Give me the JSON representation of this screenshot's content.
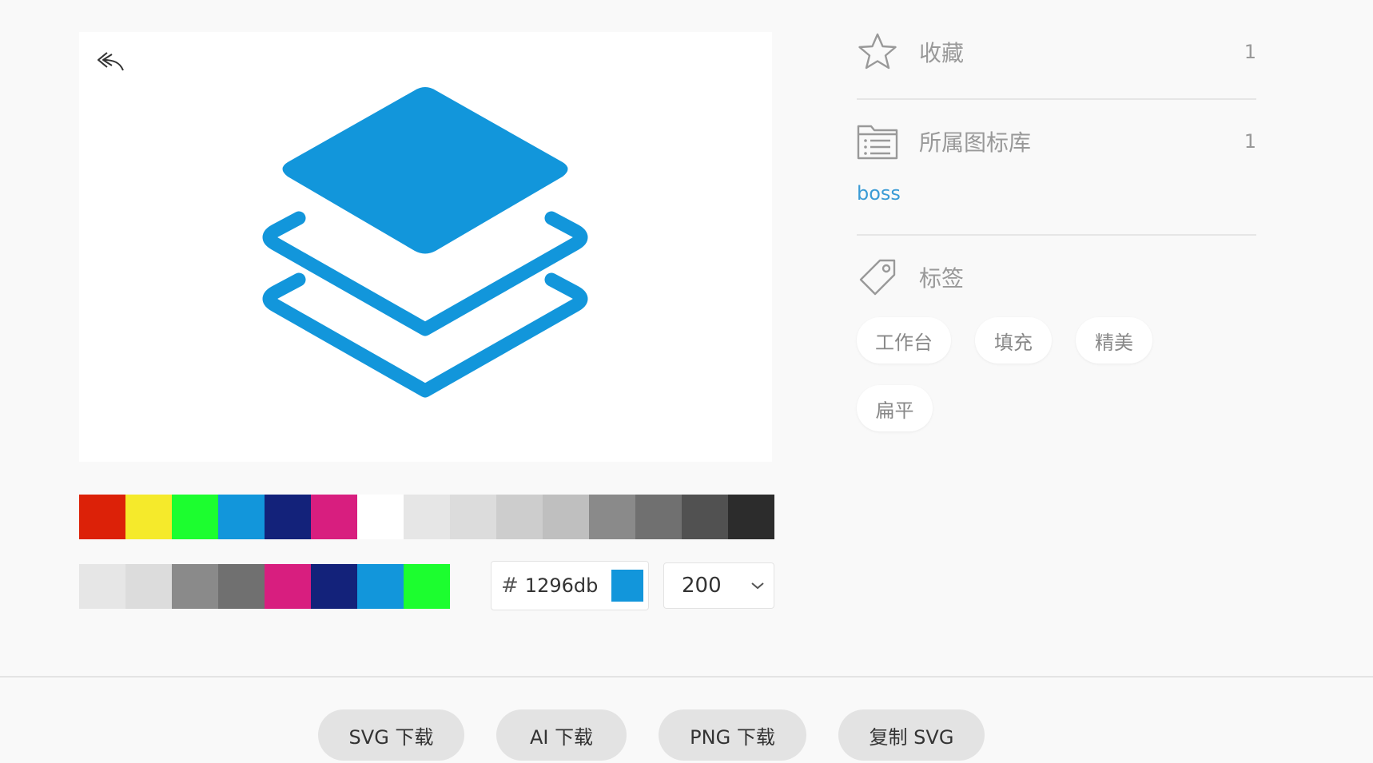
{
  "colors": {
    "accent": "#1296db",
    "link": "#3a9bd5"
  },
  "preview": {
    "back_icon": "undo-arrow-icon",
    "icon_name": "layers-icon"
  },
  "palette_primary": [
    "#dc2108",
    "#f5ea2b",
    "#1cfe2f",
    "#1296db",
    "#13227a",
    "#d81e7f",
    "#ffffff",
    "#e6e6e6",
    "#dcdcdc",
    "#cdcdcd",
    "#bfbfbf",
    "#8a8a8a",
    "#707070",
    "#515151",
    "#2c2c2c"
  ],
  "palette_recent": [
    "#e6e6e6",
    "#dcdcdc",
    "#8a8a8a",
    "#707070",
    "#d81e7f",
    "#13227a",
    "#1296db",
    "#1cfe2f"
  ],
  "color_input": {
    "hash": "#",
    "value": "1296db",
    "swatch": "#1296db"
  },
  "size_select": {
    "value": "200"
  },
  "sidebar": {
    "favorite": {
      "label": "收藏",
      "count": "1",
      "icon": "star-icon"
    },
    "library": {
      "label": "所属图标库",
      "count": "1",
      "icon": "folder-list-icon",
      "link": "boss"
    },
    "tags": {
      "label": "标签",
      "icon": "tag-icon",
      "items": [
        "工作台",
        "填充",
        "精美",
        "扁平"
      ]
    }
  },
  "footer": {
    "buttons": [
      "SVG 下载",
      "AI 下载",
      "PNG 下载",
      "复制 SVG"
    ]
  }
}
